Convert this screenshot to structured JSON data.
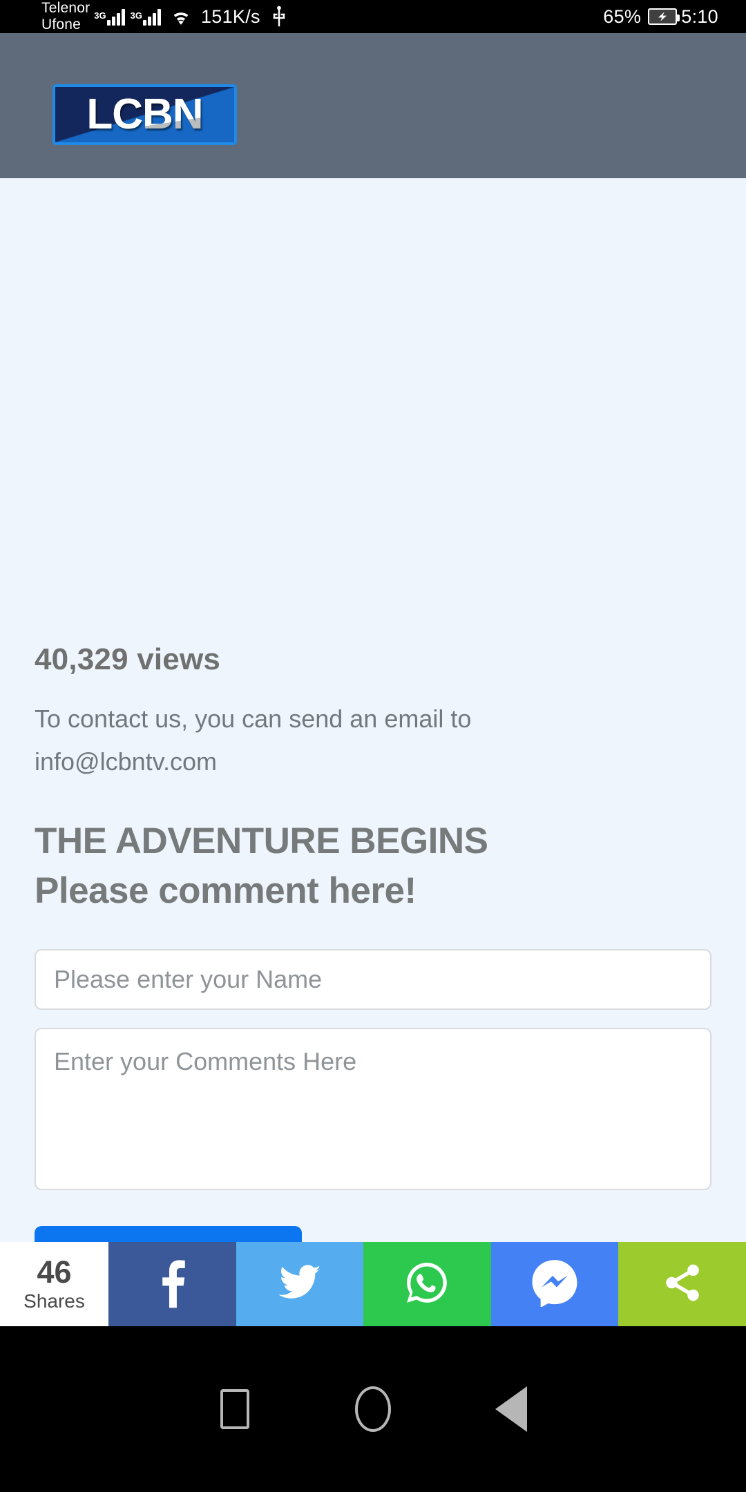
{
  "statusbar": {
    "carrier_1": "Telenor",
    "carrier_2": "Ufone",
    "net_tag_1": "3G",
    "net_tag_2": "3G",
    "net_speed": "151K/s",
    "battery_percent": "65%",
    "clock": "5:10",
    "icons": [
      "signal-bars-icon",
      "wifi-icon",
      "usb-icon",
      "battery-charging-icon"
    ]
  },
  "header": {
    "logo_text": "LCBN",
    "background_color": "#5f6a7b",
    "logo_border_color": "#1f8ae8",
    "logo_fill_color": "#13275c"
  },
  "content": {
    "views": "40,329 views",
    "contact_text": "To contact us, you can send an email to info@lcbntv.com",
    "heading_primary": "THE ADVENTURE BEGINS",
    "heading_secondary": "Please comment here!",
    "background_color": "#eef5fd"
  },
  "form": {
    "name_value": "",
    "name_placeholder": "Please enter your Name",
    "comments_value": "",
    "comments_placeholder": "Enter your Comments Here",
    "submit_color": "#0b76f0"
  },
  "sharebar": {
    "count": "46",
    "count_label": "Shares",
    "buttons": [
      {
        "name": "facebook",
        "color": "#3b5998"
      },
      {
        "name": "twitter",
        "color": "#55acee"
      },
      {
        "name": "whatsapp",
        "color": "#2dc94e"
      },
      {
        "name": "messenger",
        "color": "#4481f4"
      },
      {
        "name": "share",
        "color": "#9ccb2e"
      }
    ]
  },
  "navbar": {
    "recents_label": "Recents",
    "home_label": "Home",
    "back_label": "Back"
  }
}
